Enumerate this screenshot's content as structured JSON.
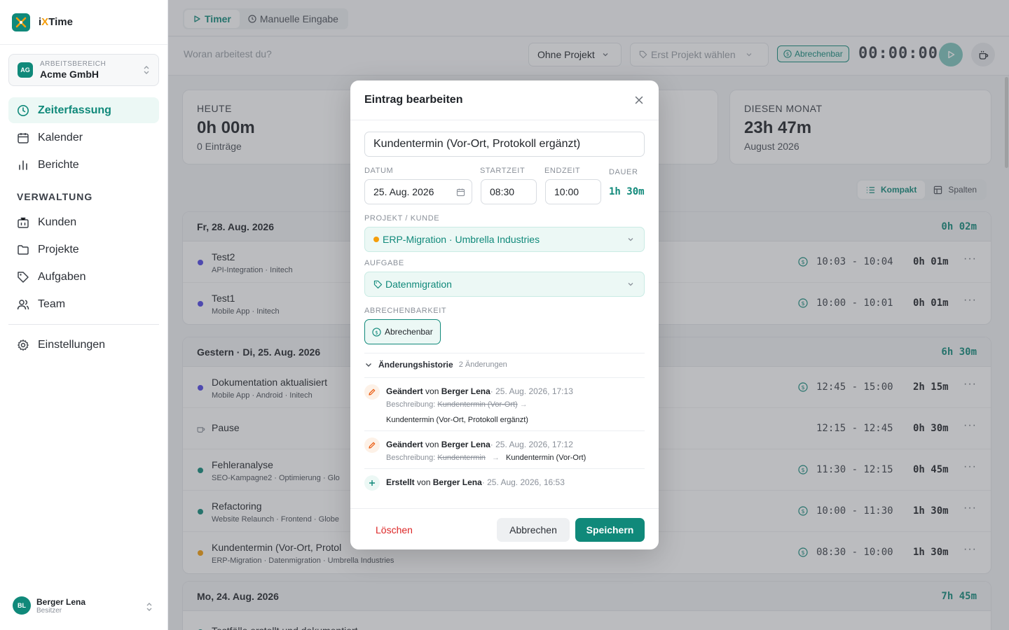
{
  "app": {
    "name_prefix": "i",
    "name_x": "X",
    "name_suffix": "Time"
  },
  "workspace": {
    "caption": "ARBEITSBEREICH",
    "badge": "AG",
    "name": "Acme GmbH"
  },
  "nav": {
    "zeiterfassung": "Zeiterfassung",
    "kalender": "Kalender",
    "berichte": "Berichte",
    "section": "VERWALTUNG",
    "kunden": "Kunden",
    "projekte": "Projekte",
    "aufgaben": "Aufgaben",
    "team": "Team",
    "einstellungen": "Einstellungen"
  },
  "user": {
    "initials": "BL",
    "name": "Berger Lena",
    "role": "Besitzer"
  },
  "topbar": {
    "tab_timer": "Timer",
    "tab_manual": "Manuelle Eingabe"
  },
  "timerbar": {
    "placeholder": "Woran arbeitest du?",
    "project": "Ohne Projekt",
    "task": "Erst Projekt wählen",
    "billable": "Abrechenbar",
    "clock": "00:00:00"
  },
  "stats": {
    "today": {
      "caption": "HEUTE",
      "value": "0h 00m",
      "sub": "0 Einträge"
    },
    "month": {
      "caption": "DIESEN MONAT",
      "value": "23h 47m",
      "sub": "August 2026"
    }
  },
  "view": {
    "compact": "Kompakt",
    "columns": "Spalten"
  },
  "days": [
    {
      "title": "Fr, 28. Aug. 2026",
      "total": "0h 02m",
      "rows": [
        {
          "title": "Test2",
          "sub": "API-Integration · Initech",
          "time": "10:03 - 10:04",
          "dur": "0h 01m",
          "color": "#4f46e5"
        },
        {
          "title": "Test1",
          "sub": "Mobile App · Initech",
          "time": "10:00 - 10:01",
          "dur": "0h 01m",
          "color": "#4f46e5"
        }
      ]
    },
    {
      "title": "Gestern · Di, 25. Aug. 2026",
      "total": "6h 30m",
      "rows": [
        {
          "title": "Dokumentation aktualisiert",
          "sub": "Mobile App · Android · Initech",
          "time": "12:45 - 15:00",
          "dur": "2h 15m",
          "color": "#4f46e5"
        },
        {
          "title": "Pause",
          "sub": "",
          "time": "12:15 - 12:45",
          "dur": "0h 30m",
          "color": ""
        },
        {
          "title": "Fehleranalyse",
          "sub": "SEO-Kampagne2 · Optimierung · Glo",
          "time": "11:30 - 12:15",
          "dur": "0h 45m",
          "color": "#10897a"
        },
        {
          "title": "Refactoring",
          "sub": "Website Relaunch · Frontend · Globe",
          "time": "10:00 - 11:30",
          "dur": "1h 30m",
          "color": "#10897a"
        },
        {
          "title": "Kundentermin (Vor-Ort, Protol",
          "sub": "ERP-Migration · Datenmigration · Umbrella Industries",
          "time": "08:30 - 10:00",
          "dur": "1h 30m",
          "color": "#f59e0b"
        }
      ]
    },
    {
      "title": "Mo, 24. Aug. 2026",
      "total": "7h 45m",
      "rows": [
        {
          "title": "Testfälle erstellt und dokumentiert",
          "sub": "",
          "time": "",
          "dur": "",
          "color": "#10897a"
        }
      ]
    }
  ],
  "modal": {
    "title": "Eintrag bearbeiten",
    "description": "Kundentermin (Vor-Ort, Protokoll ergänzt)",
    "label_date": "DATUM",
    "label_start": "STARTZEIT",
    "label_end": "ENDZEIT",
    "label_duration": "DAUER",
    "date": "25. Aug. 2026",
    "start": "08:30",
    "end": "10:00",
    "duration": "1h 30m",
    "label_project": "PROJEKT / KUNDE",
    "project": "ERP-Migration · Umbrella Industries",
    "label_task": "AUFGABE",
    "task": "Datenmigration",
    "label_billing": "ABRECHENBARKEIT",
    "billable": "Abrechenbar",
    "history_title": "Änderungshistorie",
    "history_count": "2 Änderungen",
    "history": [
      {
        "action": "Geändert",
        "by": "von",
        "user": "Berger Lena",
        "date": "· 25. Aug. 2026, 17:13",
        "field": "Beschreibung:",
        "old": "Kundentermin (Vor-Ort)",
        "new": "Kundentermin (Vor-Ort, Protokoll ergänzt)"
      },
      {
        "action": "Geändert",
        "by": "von",
        "user": "Berger Lena",
        "date": "· 25. Aug. 2026, 17:12",
        "field": "Beschreibung:",
        "old": "Kundentermin",
        "new": "Kundentermin (Vor-Ort)"
      },
      {
        "action": "Erstellt",
        "by": "von",
        "user": "Berger Lena",
        "date": "· 25. Aug. 2026, 16:53"
      }
    ],
    "delete": "Löschen",
    "cancel": "Abbrechen",
    "save": "Speichern"
  },
  "colors": {
    "accent": "#10897a",
    "danger": "#dc2626",
    "warning": "#f59e0b"
  }
}
